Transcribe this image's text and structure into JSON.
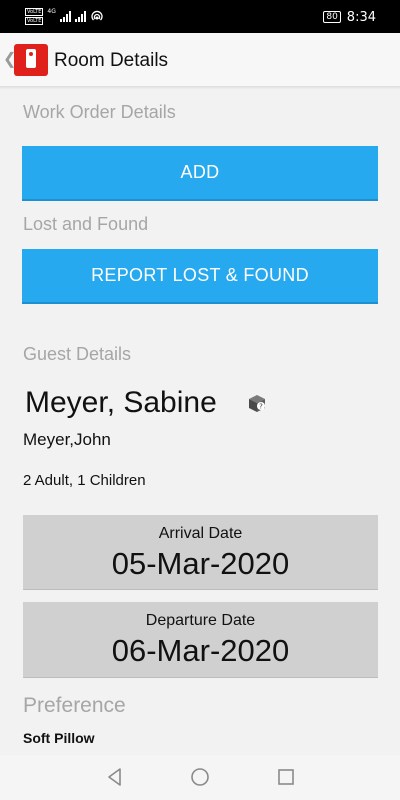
{
  "status_bar": {
    "volte_1": "VoLTE",
    "volte_2": "VoLTE",
    "network_type": "4G",
    "battery": "80",
    "time": "8:34",
    "icons": [
      "signal-icon",
      "wifi-hotspot-icon",
      "battery-icon"
    ]
  },
  "app_bar": {
    "title": "Room Details",
    "logo_icon": "room-tag-icon",
    "accent_color": "#e0201a"
  },
  "work_order": {
    "label": "Work Order Details",
    "button_label": "ADD"
  },
  "lost_found": {
    "label": "Lost and Found",
    "button_label": "REPORT LOST & FOUND"
  },
  "guest": {
    "label": "Guest Details",
    "name": "Meyer, Sabine",
    "icon": "guest-profile-icon",
    "co_guest": "Meyer,John",
    "occupancy": "2 Adult, 1 Children"
  },
  "arrival": {
    "label": "Arrival Date",
    "date": "05-Mar-2020"
  },
  "departure": {
    "label": "Departure Date",
    "date": "06-Mar-2020"
  },
  "preference": {
    "label": "Preference",
    "value": "Soft Pillow"
  },
  "nav_bar": {
    "icons": [
      "back-triangle-icon",
      "home-circle-icon",
      "recents-square-icon"
    ]
  },
  "colors": {
    "button_blue": "#27a9f0",
    "section_label_gray": "#a6a6a6",
    "date_box_gray": "#d0d0d0"
  }
}
